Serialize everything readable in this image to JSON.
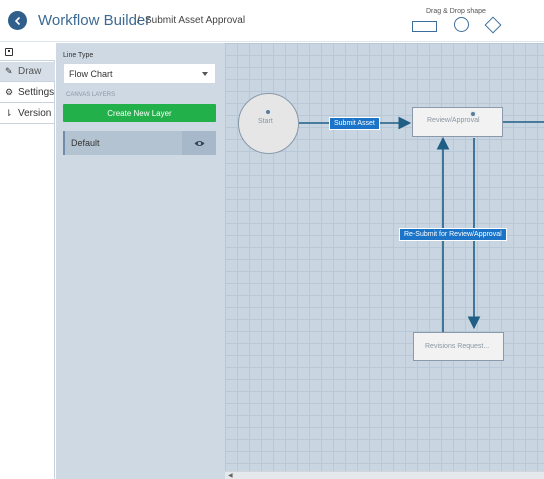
{
  "header": {
    "title": "Workflow Builder",
    "separator": "/",
    "breadcrumb": "Submit Asset Approval",
    "dragdrop_title": "Drag & Drop shape",
    "shapes": [
      "rectangle-shape",
      "circle-shape",
      "diamond-shape"
    ]
  },
  "tabs": [
    {
      "label": "",
      "icon": "square-icon"
    },
    {
      "label": "Draw",
      "icon": "pencil-icon",
      "active": true
    },
    {
      "label": "Settings",
      "icon": "gear-icon"
    },
    {
      "label": "Version",
      "icon": "version-icon"
    }
  ],
  "panel": {
    "line_type_label": "Line Type",
    "line_type_value": "Flow Chart",
    "canvas_layers_label": "CANVAS LAYERS",
    "create_layer_label": "Create New Layer",
    "layers": [
      {
        "name": "Default",
        "visible": true
      }
    ]
  },
  "canvas": {
    "nodes": {
      "start": "Start",
      "review": "Review/Approval",
      "revisions": "Revisions Request..."
    },
    "edges": {
      "submit": "Submit Asset",
      "resubmit": "Re-Submit for Review/Approval"
    }
  },
  "colors": {
    "accent": "#3d6a94",
    "create_button": "#21b04a",
    "edge_label": "#1b74c8",
    "connector": "#1f5e85"
  }
}
